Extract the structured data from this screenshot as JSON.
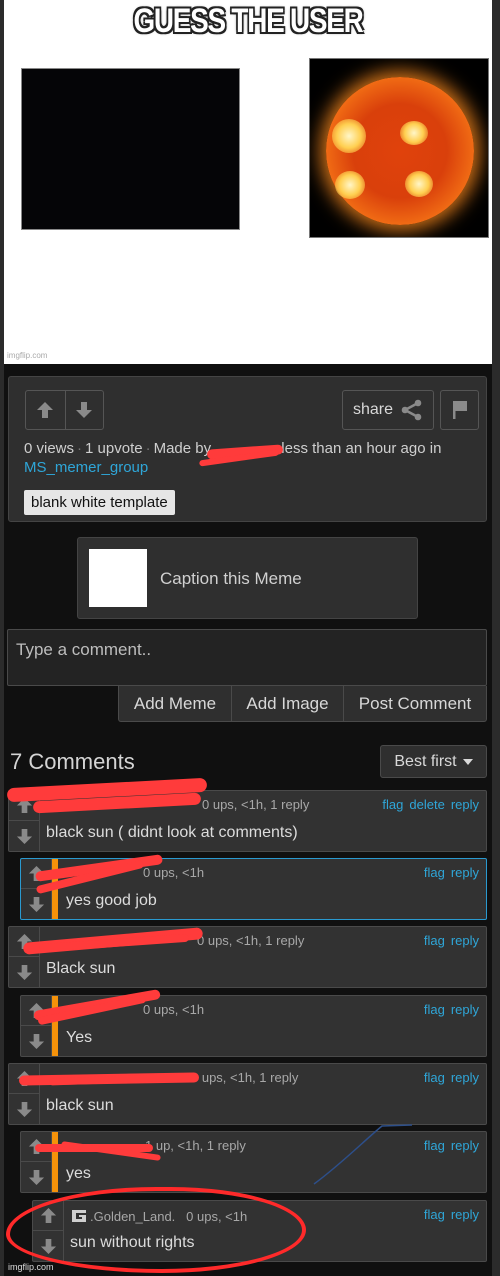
{
  "meme": {
    "title": "GUESS THE USER",
    "watermark": "imgflip.com",
    "panels": [
      "black-rectangle",
      "sun-photo"
    ]
  },
  "post": {
    "vote": {
      "up_icon": "arrow-up-icon",
      "down_icon": "arrow-down-icon"
    },
    "share_label": "share",
    "views": "0 views",
    "upvotes": "1 upvote",
    "made_by_prefix": "Made by",
    "made_by_user": "[redacted]",
    "time_text": "less than an hour ago in",
    "group": "MS_memer_group",
    "tag": "blank white template"
  },
  "caption": {
    "label": "Caption this Meme"
  },
  "comment_form": {
    "placeholder": "Type a comment..",
    "value": "",
    "buttons": [
      "Add Meme",
      "Add Image",
      "Post Comment"
    ]
  },
  "comments_header": {
    "count_label": "7 Comments",
    "sort_value": "Best first"
  },
  "comments": [
    {
      "user": "[redacted]",
      "meta": "0 ups, <1h, 1 reply",
      "text": "black sun ( didnt look at comments)",
      "actions": [
        "flag",
        "delete",
        "reply"
      ],
      "is_reply": false
    },
    {
      "user": "[redacted]",
      "meta": "0 ups, <1h",
      "text": "yes good job",
      "actions": [
        "flag",
        "reply"
      ],
      "is_reply": true
    },
    {
      "user": "[redacted]",
      "meta": "0 ups, <1h, 1 reply",
      "text": "Black sun",
      "actions": [
        "flag",
        "reply"
      ],
      "is_reply": false
    },
    {
      "user": "[redacted]",
      "meta": "0 ups, <1h",
      "text": "Yes",
      "actions": [
        "flag",
        "reply"
      ],
      "is_reply": true
    },
    {
      "user": "[redacted]",
      "meta": "0 ups, <1h, 1 reply",
      "text": "black sun",
      "actions": [
        "flag",
        "reply"
      ],
      "is_reply": false
    },
    {
      "user": "[redacted]",
      "meta": "1 up, <1h, 1 reply",
      "text": "yes",
      "actions": [
        "flag",
        "reply"
      ],
      "is_reply": true
    },
    {
      "user": ".Golden_Land.",
      "meta": "0 ups, <1h",
      "text": "sun without rights",
      "actions": [
        "flag",
        "reply"
      ],
      "is_reply": true
    }
  ],
  "footer_watermark": "imgflip.com",
  "colors": {
    "link": "#2fa6d8",
    "reply_bar": "#f5920a",
    "redaction": "#ff3b3b",
    "annotation_circle": "#ff2a2a",
    "highlight_border": "#2a9ad0"
  }
}
